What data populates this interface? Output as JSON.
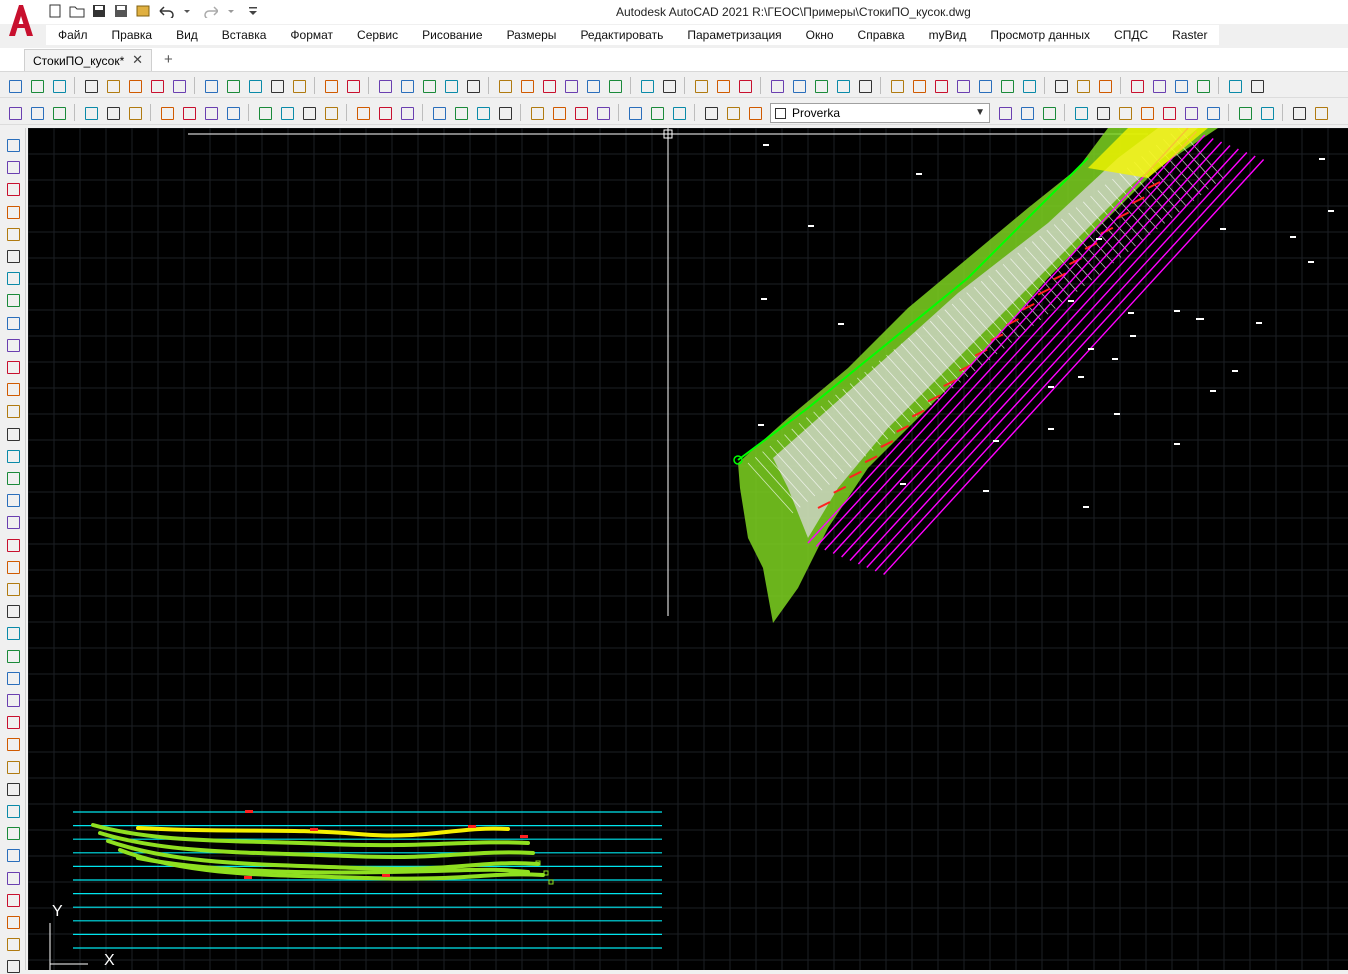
{
  "title": "Autodesk AutoCAD 2021     R:\\ГЕОС\\Примеры\\СтокиПО_кусок.dwg",
  "menu": [
    "Файл",
    "Правка",
    "Вид",
    "Вставка",
    "Формат",
    "Сервис",
    "Рисование",
    "Размеры",
    "Редактировать",
    "Параметризация",
    "Окно",
    "Справка",
    "myВид",
    "Просмотр данных",
    "СПДС",
    "Raster"
  ],
  "tabs": {
    "active": "СтокиПО_кусок*",
    "close": "✕",
    "new": "+"
  },
  "layer": {
    "current": "Proverka",
    "arrow": "▼"
  },
  "ucs": {
    "y": "Y",
    "x": "X"
  },
  "colors": {
    "canvas": "#000000",
    "grid": "#1e2226",
    "accent_red": "#c8102e"
  }
}
